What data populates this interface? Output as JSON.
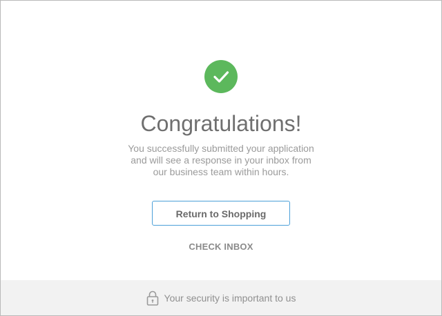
{
  "success": {
    "icon": "check-icon",
    "accent_color": "#5cb85c"
  },
  "title": "Congratulations!",
  "message": {
    "line1": "You successfully submitted your application",
    "line2": "and will see a response in your inbox from",
    "line3": "our business team within hours."
  },
  "actions": {
    "return_label": "Return to Shopping",
    "check_inbox_label": "CHECK INBOX"
  },
  "footer": {
    "icon": "lock-icon",
    "text": "Your security is important to us"
  }
}
